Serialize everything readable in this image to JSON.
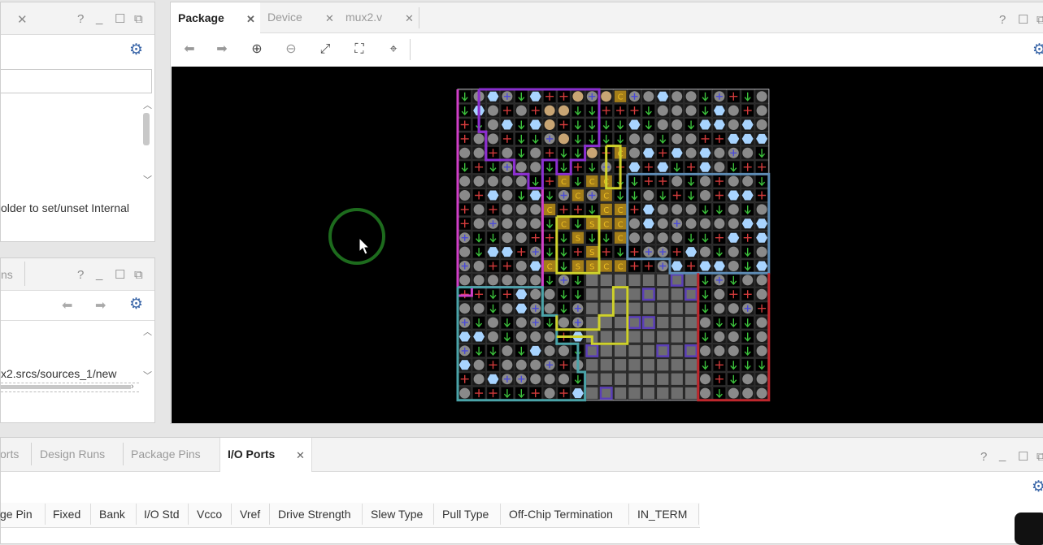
{
  "left_panel_top": {
    "text": "older to set/unset Internal"
  },
  "left_panel_mid": {
    "tab_fragment": "ns",
    "path_text": "x2.srcs/sources_1/new"
  },
  "editor": {
    "tabs": [
      {
        "label": "Package",
        "active": true
      },
      {
        "label": "Device",
        "active": false
      },
      {
        "label": "mux2.v",
        "active": false
      }
    ],
    "toolbar": [
      "back-icon",
      "forward-icon",
      "zoom-in-icon",
      "zoom-out-icon",
      "zoom-fit-icon",
      "zoom-selection-icon",
      "crosshair-icon"
    ]
  },
  "package_view": {
    "background": "#000000",
    "pin_labels": [
      "S",
      "C",
      "G"
    ],
    "bank_colors": {
      "magenta": "#d13fc8",
      "purple": "#8a2fd0",
      "yellow": "#cfd22a",
      "teal": "#4aa3a8",
      "steelblue": "#5d8bb4",
      "red": "#c0272d",
      "violet": "#5b3fb8"
    },
    "bank_count": 7
  },
  "bottom_panel": {
    "tabs": [
      {
        "label": "orts",
        "active": false
      },
      {
        "label": "Design Runs",
        "active": false
      },
      {
        "label": "Package Pins",
        "active": false
      },
      {
        "label": "I/O Ports",
        "active": true
      }
    ],
    "columns": [
      "ge Pin",
      "Fixed",
      "Bank",
      "I/O Std",
      "Vcco",
      "Vref",
      "Drive Strength",
      "Slew Type",
      "Pull Type",
      "Off-Chip Termination",
      "IN_TERM"
    ]
  }
}
